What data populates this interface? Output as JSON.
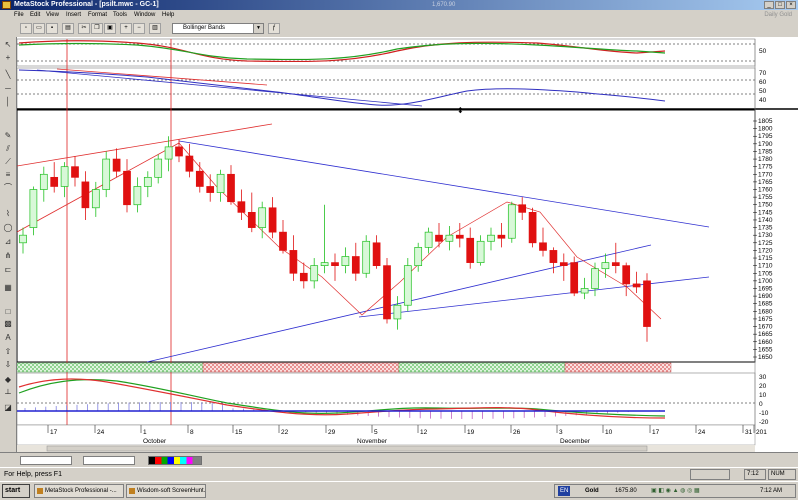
{
  "window": {
    "title": "MetaStock Professional - [psilt.mwc - GC-1]",
    "coords": "1,670.90",
    "doc_label": "Daily Gold"
  },
  "menu": [
    "File",
    "Edit",
    "View",
    "Insert",
    "Format",
    "Tools",
    "Window",
    "Help"
  ],
  "toolbar": {
    "indicator_select": "Bollinger Bands"
  },
  "status": {
    "help_text": "For Help, press F1",
    "time": "7:12",
    "num": "NUM"
  },
  "taskbar": {
    "start": "start",
    "tasks": [
      "MetaStock Professional -...",
      "Wisdom-soft ScreenHunt..."
    ],
    "lang": "EN",
    "ticker_name": "Gold",
    "ticker_value": "1675.80",
    "clock": "7:12 AM"
  },
  "right_scale": {
    "osc1": [
      "50"
    ],
    "osc2": [
      "70",
      "60",
      "50",
      "40"
    ],
    "price": [
      "1805",
      "1800",
      "1795",
      "1790",
      "1785",
      "1780",
      "1775",
      "1770",
      "1765",
      "1760",
      "1755",
      "1750",
      "1745",
      "1740",
      "1735",
      "1730",
      "1725",
      "1720",
      "1715",
      "1710",
      "1705",
      "1700",
      "1695",
      "1690",
      "1685",
      "1680",
      "1675",
      "1670",
      "1665",
      "1660",
      "1655",
      "1650"
    ],
    "macd": [
      "30",
      "20",
      "10",
      "0",
      "-10",
      "-20"
    ]
  },
  "date_axis": {
    "day_labels": [
      "17",
      "24",
      "1",
      "8",
      "15",
      "22",
      "29",
      "5",
      "12",
      "19",
      "26",
      "3",
      "10",
      "17",
      "24",
      "31",
      "201"
    ],
    "month_labels": [
      "October",
      "November",
      "December"
    ]
  },
  "chart_data": {
    "type": "candlestick",
    "symbol": "GC-1",
    "ylim": [
      1650,
      1805
    ],
    "series": [
      {
        "values_ohlc": [
          [
            1725,
            1735,
            1718,
            1730
          ],
          [
            1735,
            1762,
            1730,
            1760
          ],
          [
            1760,
            1775,
            1752,
            1770
          ],
          [
            1768,
            1778,
            1758,
            1762
          ],
          [
            1762,
            1778,
            1755,
            1775
          ],
          [
            1775,
            1782,
            1762,
            1768
          ],
          [
            1765,
            1772,
            1740,
            1748
          ],
          [
            1748,
            1765,
            1742,
            1760
          ],
          [
            1760,
            1785,
            1755,
            1780
          ],
          [
            1780,
            1787,
            1768,
            1772
          ],
          [
            1772,
            1780,
            1745,
            1750
          ],
          [
            1750,
            1768,
            1745,
            1762
          ],
          [
            1762,
            1772,
            1755,
            1768
          ],
          [
            1768,
            1783,
            1764,
            1780
          ],
          [
            1780,
            1795,
            1772,
            1788
          ],
          [
            1788,
            1793,
            1778,
            1782
          ],
          [
            1782,
            1790,
            1768,
            1772
          ],
          [
            1772,
            1778,
            1758,
            1762
          ],
          [
            1762,
            1770,
            1752,
            1758
          ],
          [
            1758,
            1773,
            1752,
            1770
          ],
          [
            1770,
            1776,
            1750,
            1752
          ],
          [
            1752,
            1760,
            1740,
            1745
          ],
          [
            1745,
            1758,
            1732,
            1735
          ],
          [
            1735,
            1752,
            1728,
            1748
          ],
          [
            1748,
            1755,
            1728,
            1732
          ],
          [
            1732,
            1740,
            1718,
            1720
          ],
          [
            1720,
            1730,
            1700,
            1705
          ],
          [
            1705,
            1712,
            1695,
            1700
          ],
          [
            1700,
            1715,
            1695,
            1710
          ],
          [
            1710,
            1750,
            1705,
            1712
          ],
          [
            1712,
            1718,
            1700,
            1710
          ],
          [
            1710,
            1722,
            1705,
            1716
          ],
          [
            1716,
            1725,
            1700,
            1705
          ],
          [
            1705,
            1730,
            1702,
            1726
          ],
          [
            1725,
            1730,
            1708,
            1710
          ],
          [
            1710,
            1715,
            1672,
            1675
          ],
          [
            1675,
            1690,
            1668,
            1684
          ],
          [
            1684,
            1715,
            1680,
            1710
          ],
          [
            1710,
            1725,
            1706,
            1722
          ],
          [
            1722,
            1735,
            1718,
            1732
          ],
          [
            1730,
            1738,
            1722,
            1726
          ],
          [
            1726,
            1736,
            1720,
            1730
          ],
          [
            1730,
            1738,
            1722,
            1728
          ],
          [
            1728,
            1735,
            1708,
            1712
          ],
          [
            1712,
            1730,
            1710,
            1726
          ],
          [
            1726,
            1735,
            1720,
            1730
          ],
          [
            1730,
            1738,
            1722,
            1728
          ],
          [
            1728,
            1752,
            1725,
            1750
          ],
          [
            1750,
            1755,
            1740,
            1745
          ],
          [
            1745,
            1748,
            1722,
            1725
          ],
          [
            1725,
            1735,
            1716,
            1720
          ],
          [
            1720,
            1722,
            1705,
            1712
          ],
          [
            1712,
            1718,
            1700,
            1710
          ],
          [
            1712,
            1716,
            1690,
            1692
          ],
          [
            1692,
            1702,
            1688,
            1695
          ],
          [
            1695,
            1712,
            1690,
            1708
          ],
          [
            1708,
            1718,
            1702,
            1712
          ],
          [
            1712,
            1725,
            1705,
            1710
          ],
          [
            1710,
            1712,
            1690,
            1698
          ],
          [
            1698,
            1706,
            1692,
            1696
          ],
          [
            1700,
            1705,
            1660,
            1670
          ]
        ]
      }
    ]
  }
}
